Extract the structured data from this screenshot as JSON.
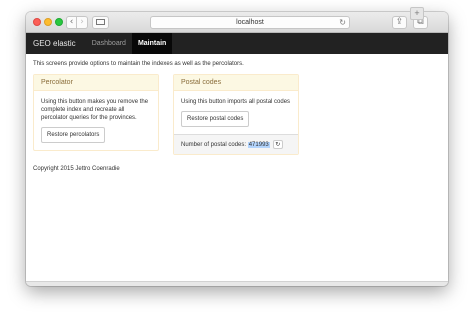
{
  "browser": {
    "url": "localhost",
    "icons": {
      "back": "‹",
      "forward": "›",
      "reload": "↻",
      "share": "⇪",
      "tabs": "⧉",
      "new_tab": "+"
    }
  },
  "navbar": {
    "brand": "GEO elastic",
    "items": [
      {
        "label": "Dashboard"
      },
      {
        "label": "Maintain",
        "active": true
      }
    ]
  },
  "main": {
    "intro": "This screens provide options to maintain the indexes as well as the percolators.",
    "percolator": {
      "title": "Percolator",
      "description": "Using this button makes you remove the complete index and recreate all percolator queries for the provinces.",
      "button": "Restore percolators"
    },
    "postal": {
      "title": "Postal codes",
      "description": "Using this button imports all postal codes",
      "button": "Restore postal codes",
      "count_label": "Number of postal codes:",
      "count": "471993",
      "refresh_icon": "↻"
    },
    "footer": "Copyright 2015 Jettro Coenradie"
  },
  "colors": {
    "navbar": "#222222",
    "panel_heading_bg": "#fcf8e3",
    "panel_heading_text": "#8a6d3b",
    "panel_border": "#faebcc",
    "selection": "#b3d4fc"
  }
}
